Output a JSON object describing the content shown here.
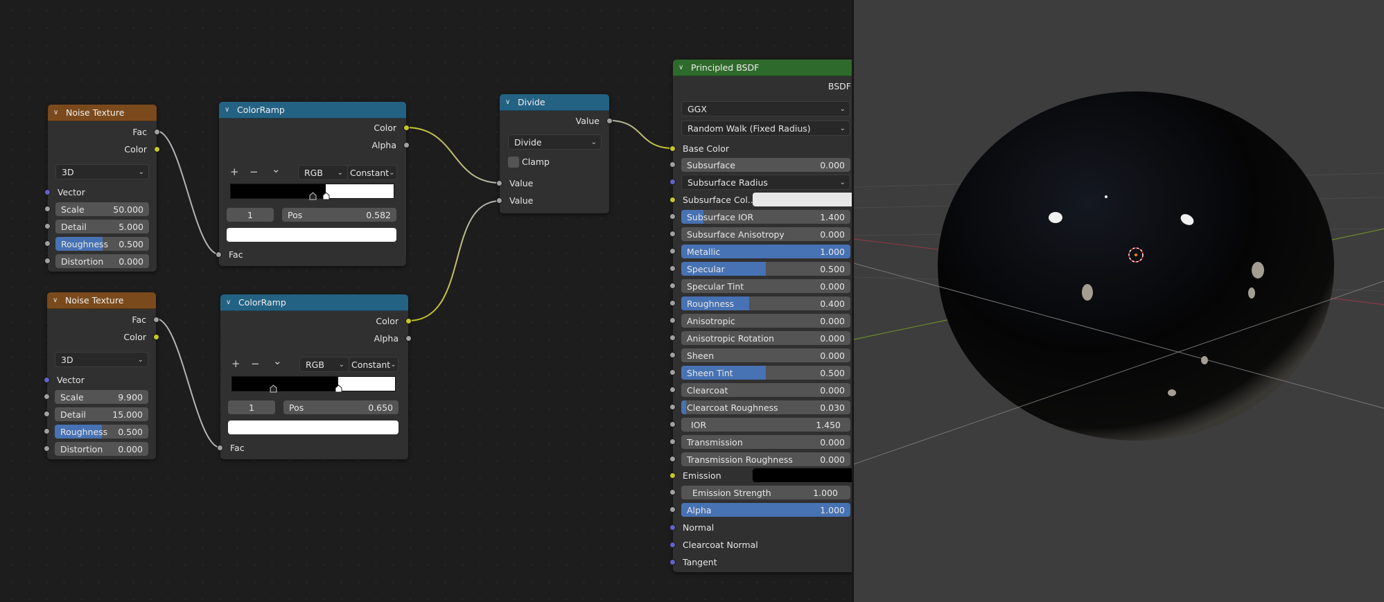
{
  "colors": {
    "texture_header": "#7b4a1c",
    "converter_header": "#246283",
    "shader_header": "#2e6a2b",
    "slider_fill": "#4772b3",
    "socket_float": "#a1a1a1",
    "socket_color": "#c7c729",
    "socket_vector": "#6363c7"
  },
  "nodes": {
    "noise1": {
      "title": "Noise Texture",
      "outputs": [
        "Fac",
        "Color"
      ],
      "dimension": "3D",
      "vector_label": "Vector",
      "fields": [
        {
          "label": "Scale",
          "value": "50.000",
          "fill": 0
        },
        {
          "label": "Detail",
          "value": "5.000",
          "fill": 0
        },
        {
          "label": "Roughness",
          "value": "0.500",
          "fill": 0.5
        },
        {
          "label": "Distortion",
          "value": "0.000",
          "fill": 0
        }
      ]
    },
    "noise2": {
      "title": "Noise Texture",
      "outputs": [
        "Fac",
        "Color"
      ],
      "dimension": "3D",
      "vector_label": "Vector",
      "fields": [
        {
          "label": "Scale",
          "value": "9.900",
          "fill": 0
        },
        {
          "label": "Detail",
          "value": "15.000",
          "fill": 0
        },
        {
          "label": "Roughness",
          "value": "0.500",
          "fill": 0.5
        },
        {
          "label": "Distortion",
          "value": "0.000",
          "fill": 0
        }
      ]
    },
    "ramp1": {
      "title": "ColorRamp",
      "outputs": [
        "Color",
        "Alpha"
      ],
      "add": "+",
      "remove": "−",
      "menu": "⌄",
      "color_mode": "RGB",
      "interpolation": "Constant",
      "stops": [
        0.5,
        0.582
      ],
      "active_index": "1",
      "pos_label": "Pos",
      "pos_value": "0.582",
      "input": "Fac"
    },
    "ramp2": {
      "title": "ColorRamp",
      "outputs": [
        "Color",
        "Alpha"
      ],
      "add": "+",
      "remove": "−",
      "menu": "⌄",
      "color_mode": "RGB",
      "interpolation": "Constant",
      "stops": [
        0.25,
        0.65
      ],
      "active_index": "1",
      "pos_label": "Pos",
      "pos_value": "0.650",
      "input": "Fac"
    },
    "divide": {
      "title": "Divide",
      "output": "Value",
      "operation": "Divide",
      "clamp_label": "Clamp",
      "clamp": false,
      "inputs": [
        "Value",
        "Value"
      ]
    },
    "bsdf": {
      "title": "Principled BSDF",
      "output": "BSDF",
      "distribution": "GGX",
      "subsurface_method": "Random Walk (Fixed Radius)",
      "base_color_label": "Base Color",
      "subsurface": {
        "label": "Subsurface",
        "value": "0.000",
        "fill": 0
      },
      "subsurface_radius": "Subsurface Radius",
      "subsurface_color_label": "Subsurface Col...",
      "sliders": [
        {
          "label": "Subsurface IOR",
          "value": "1.400",
          "fill": 0.13
        },
        {
          "label": "Subsurface Anisotropy",
          "value": "0.000",
          "fill": 0
        },
        {
          "label": "Metallic",
          "value": "1.000",
          "fill": 1
        },
        {
          "label": "Specular",
          "value": "0.500",
          "fill": 0.5
        },
        {
          "label": "Specular Tint",
          "value": "0.000",
          "fill": 0
        },
        {
          "label": "Roughness",
          "value": "0.400",
          "fill": 0.4
        },
        {
          "label": "Anisotropic",
          "value": "0.000",
          "fill": 0
        },
        {
          "label": "Anisotropic Rotation",
          "value": "0.000",
          "fill": 0
        },
        {
          "label": "Sheen",
          "value": "0.000",
          "fill": 0
        },
        {
          "label": "Sheen Tint",
          "value": "0.500",
          "fill": 0.5
        },
        {
          "label": "Clearcoat",
          "value": "0.000",
          "fill": 0
        },
        {
          "label": "Clearcoat Roughness",
          "value": "0.030",
          "fill": 0.03
        },
        {
          "label": "IOR",
          "value": "1.450",
          "fill": 0
        },
        {
          "label": "Transmission",
          "value": "0.000",
          "fill": 0
        },
        {
          "label": "Transmission Roughness",
          "value": "0.000",
          "fill": 0
        }
      ],
      "emission_label": "Emission",
      "emission_strength": {
        "label": "Emission Strength",
        "value": "1.000",
        "fill": 0
      },
      "alpha": {
        "label": "Alpha",
        "value": "1.000",
        "fill": 1
      },
      "vector_inputs": [
        "Normal",
        "Clearcoat Normal",
        "Tangent"
      ]
    }
  }
}
